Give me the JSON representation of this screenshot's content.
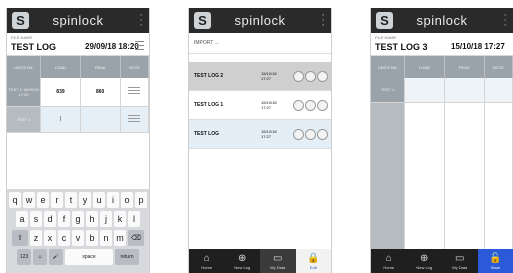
{
  "brand": "spinlock",
  "logo_letter": "S",
  "filename_label": "FILE NAME",
  "screen1": {
    "log_name": "TEST LOG",
    "date": "29/09/18 18:20",
    "headers": [
      "UNITS N/L",
      "LOAD",
      "PEAK",
      "NOTE"
    ],
    "row1_label": "TEST 1 18/09/18 17:20",
    "row1_load": "839",
    "row1_peak": "860",
    "row2_label": "TEST 2",
    "row2_input": "|",
    "keyboard": {
      "row1": [
        "q",
        "w",
        "e",
        "r",
        "t",
        "y",
        "u",
        "i",
        "o",
        "p"
      ],
      "row2": [
        "a",
        "s",
        "d",
        "f",
        "g",
        "h",
        "j",
        "k",
        "l"
      ],
      "row3": [
        "z",
        "x",
        "c",
        "v",
        "b",
        "n",
        "m"
      ],
      "shift": "⇧",
      "delete": "⌫",
      "numbers": "123",
      "emoji": "☺",
      "mic": "🎤",
      "space": "space",
      "return": "return"
    }
  },
  "screen2": {
    "import_label": "IMPORT ...",
    "logs": [
      {
        "name": "TEST LOG 2",
        "date": "15/10/18",
        "time": "17:27"
      },
      {
        "name": "TEST LOG 1",
        "date": "15/10/18",
        "time": "17:27"
      },
      {
        "name": "TEST LOG",
        "date": "15/10/18",
        "time": "17:27"
      }
    ]
  },
  "screen3": {
    "log_name": "TEST LOG 3",
    "date": "15/10/18 17:27",
    "headers": [
      "UNITS N/L",
      "LOAD",
      "PEAK",
      "NOTE"
    ],
    "row1_label": "TEST 1"
  },
  "toolbar": {
    "home": "Home",
    "new_log": "New Log",
    "my_data": "My Data",
    "edit": "Edit",
    "save": "Save"
  },
  "colors": {
    "appbar": "#2a2a2a",
    "header_grey": "#9aa3a9",
    "accent_blue": "#2a5ad8"
  }
}
